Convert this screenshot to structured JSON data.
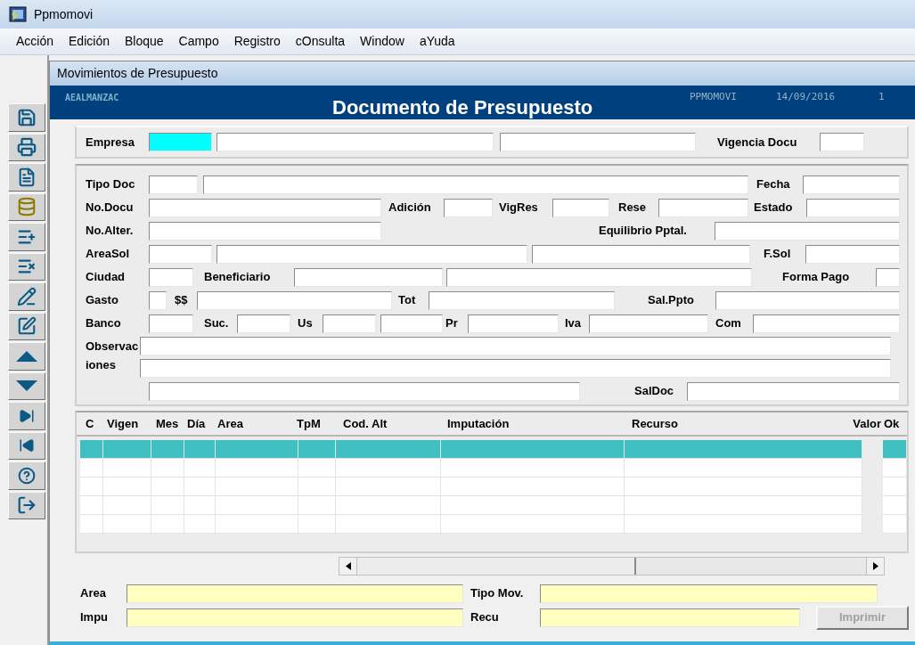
{
  "app_title": "Ppmomovi",
  "menu": [
    "Acción",
    "Edición",
    "Bloque",
    "Campo",
    "Registro",
    "cOnsulta",
    "Window",
    "aYuda"
  ],
  "form_window": {
    "title": "Movimientos de Presupuesto"
  },
  "header": {
    "user": "AEALMANZAC",
    "title": "Documento de Presupuesto",
    "module": "PPMOMOVI",
    "date": "14/09/2016",
    "extra": "1"
  },
  "company_row": [
    {
      "kind": "label",
      "text": "Empresa"
    },
    {
      "kind": "field",
      "focused": true
    },
    {
      "kind": "field",
      "focused": false
    },
    {
      "kind": "field",
      "focused": false
    },
    {
      "kind": "label",
      "text": "Vigencia Docu"
    },
    {
      "kind": "field",
      "focused": false
    }
  ],
  "form_rows": [
    [
      {
        "kind": "label",
        "text": "Tipo Doc"
      },
      {
        "kind": "field"
      },
      {
        "kind": "field"
      },
      {
        "kind": "label",
        "text": "Fecha"
      },
      {
        "kind": "field"
      }
    ],
    [
      {
        "kind": "label",
        "text": "No.Docu"
      },
      {
        "kind": "field"
      },
      {
        "kind": "label",
        "text": "Adición"
      },
      {
        "kind": "field"
      },
      {
        "kind": "label",
        "text": "VigRes"
      },
      {
        "kind": "field"
      },
      {
        "kind": "label",
        "text": "Rese"
      },
      {
        "kind": "field"
      },
      {
        "kind": "label",
        "text": "Estado"
      },
      {
        "kind": "field"
      }
    ],
    [
      {
        "kind": "label",
        "text": "No.Alter."
      },
      {
        "kind": "field"
      },
      {
        "kind": "label",
        "text": "Equilibrio Pptal."
      },
      {
        "kind": "field"
      }
    ],
    [
      {
        "kind": "label",
        "text": "AreaSol"
      },
      {
        "kind": "field"
      },
      {
        "kind": "field"
      },
      {
        "kind": "field"
      },
      {
        "kind": "label",
        "text": "F.Sol"
      },
      {
        "kind": "field"
      }
    ],
    [
      {
        "kind": "label",
        "text": "Ciudad"
      },
      {
        "kind": "field"
      },
      {
        "kind": "label",
        "text": "Beneficiario"
      },
      {
        "kind": "field"
      },
      {
        "kind": "field"
      },
      {
        "kind": "label",
        "text": "Forma Pago"
      },
      {
        "kind": "field"
      }
    ],
    [
      {
        "kind": "label",
        "text": "Gasto"
      },
      {
        "kind": "field"
      },
      {
        "kind": "label",
        "text": "$$"
      },
      {
        "kind": "field"
      },
      {
        "kind": "label",
        "text": "Tot"
      },
      {
        "kind": "field"
      },
      {
        "kind": "label",
        "text": "Sal.Ppto"
      },
      {
        "kind": "field"
      }
    ],
    [
      {
        "kind": "label",
        "text": "Banco"
      },
      {
        "kind": "field"
      },
      {
        "kind": "label",
        "text": "Suc."
      },
      {
        "kind": "field"
      },
      {
        "kind": "label",
        "text": "Us"
      },
      {
        "kind": "field"
      },
      {
        "kind": "field"
      },
      {
        "kind": "label",
        "text": "Pr"
      },
      {
        "kind": "field"
      },
      {
        "kind": "label",
        "text": "Iva"
      },
      {
        "kind": "field"
      },
      {
        "kind": "label",
        "text": "Com"
      },
      {
        "kind": "field"
      }
    ]
  ],
  "notes": {
    "label": "Observaciones"
  },
  "last_row": [
    {
      "kind": "field"
    },
    {
      "kind": "label",
      "text": "SalDoc"
    },
    {
      "kind": "field"
    }
  ],
  "grid": {
    "columns": [
      "C",
      "Vigen",
      "Mes",
      "Día",
      "Area",
      "TpM",
      "Cod. Alt",
      "Imputación",
      "Recurso",
      "Valor",
      "Ok"
    ],
    "rows": [
      {
        "selected": true
      },
      {
        "selected": false
      },
      {
        "selected": false
      },
      {
        "selected": false
      },
      {
        "selected": false
      }
    ]
  },
  "footer_rows": [
    [
      {
        "kind": "label",
        "text": "Area"
      },
      {
        "kind": "field"
      },
      {
        "kind": "label",
        "text": "Tipo Mov."
      },
      {
        "kind": "field"
      }
    ],
    [
      {
        "kind": "label",
        "text": "Impu"
      },
      {
        "kind": "field"
      },
      {
        "kind": "label",
        "text": "Recu"
      },
      {
        "kind": "field"
      },
      {
        "kind": "button",
        "text": "Imprimir",
        "disabled": true
      }
    ]
  ]
}
